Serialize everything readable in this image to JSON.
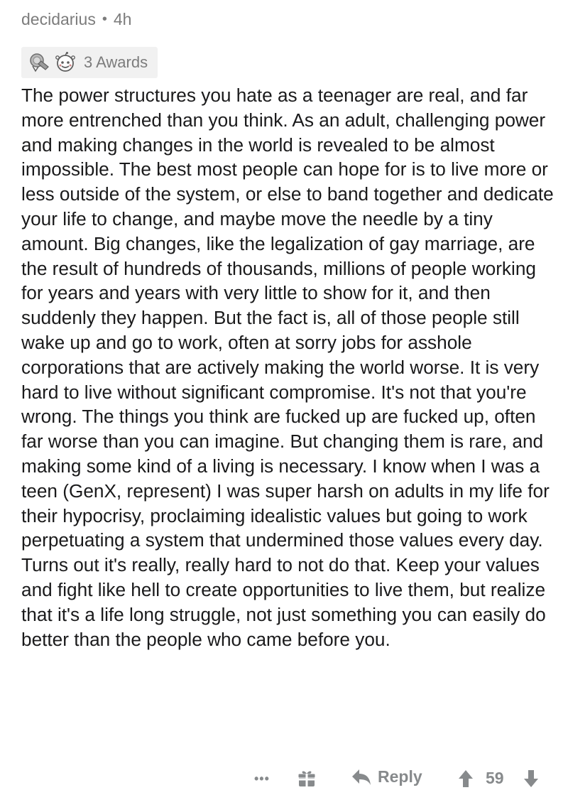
{
  "comment": {
    "author": "decidarius",
    "separator": "•",
    "time": "4h",
    "awards": {
      "icons": [
        "silver-award-icon",
        "wholesome-award-icon"
      ],
      "label": "3 Awards"
    },
    "body": "The power structures you hate as a teenager are real, and far more entrenched than you think. As an adult, challenging power and making changes in the world is revealed to be almost impossible. The best most people can hope for is to live more or less outside of the system, or else to band together and dedicate your life to change, and maybe move the needle by a tiny amount. Big changes, like the legalization of gay marriage, are the result of hundreds of thousands, millions of people working for years and years with very little to show for it, and then suddenly they happen. But the fact is, all of those people still wake up and go to work, often at sorry jobs for asshole corporations that are actively making the world worse. It is very hard to live without significant compromise. It's not that you're wrong. The things you think are fucked up are fucked up, often far worse than you can imagine. But changing them is rare, and making some kind of a living is necessary. I know when I was a teen (GenX, represent) I was super harsh on adults in my life for their hypocrisy, proclaiming idealistic values but going to work perpetuating a system that undermined those values every day. Turns out it's really, really hard to not do that. Keep your values and fight like hell to create opportunities to live them, but realize that it's a life long struggle, not just something you can easily do better than the people who came before you."
  },
  "footer": {
    "more": "•••",
    "gift_icon": "gift-icon",
    "reply_label": "Reply",
    "score": "59"
  },
  "colors": {
    "meta_gray": "#7c7c7c",
    "text": "#1a1a1b",
    "footer_gray": "#878a8c",
    "award_bg": "#f1f1f1"
  }
}
